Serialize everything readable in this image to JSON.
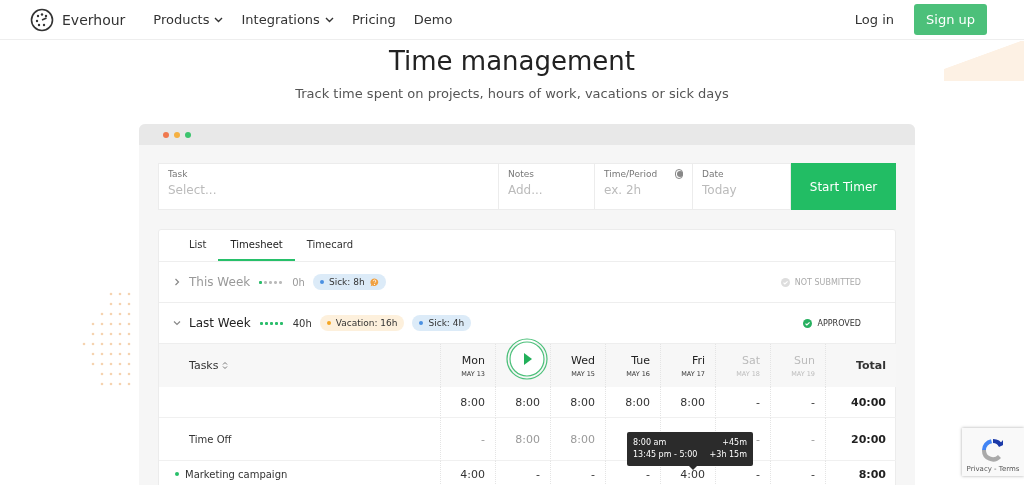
{
  "nav": {
    "brand": "Everhour",
    "links": [
      {
        "label": "Products",
        "dropdown": true
      },
      {
        "label": "Integrations",
        "dropdown": true
      },
      {
        "label": "Pricing",
        "dropdown": false
      },
      {
        "label": "Demo",
        "dropdown": false
      }
    ],
    "login": "Log in",
    "signup": "Sign up"
  },
  "hero": {
    "title": "Time management",
    "subtitle": "Track time spent on projects, hours of work, vacations or sick days"
  },
  "form": {
    "fields": [
      {
        "label": "Task",
        "placeholder": "Select..."
      },
      {
        "label": "Notes",
        "placeholder": "Add..."
      },
      {
        "label": "Time/Period",
        "placeholder": "ex. 2h",
        "toggle_on": false
      },
      {
        "label": "Date",
        "placeholder": "Today"
      }
    ],
    "button": "Start Timer"
  },
  "tabs": [
    {
      "label": "List",
      "selected": false
    },
    {
      "label": "Timesheet",
      "selected": true
    },
    {
      "label": "Timecard",
      "selected": false
    }
  ],
  "weeks": [
    {
      "title": "This Week",
      "expanded": false,
      "level": 0.17,
      "hours": "0h",
      "badges": [
        {
          "kind": "sick",
          "label": "Sick: 8h",
          "color": "#4a90e2",
          "note": true
        }
      ],
      "status": "NOT SUBMITTED",
      "approved": false
    },
    {
      "title": "Last Week",
      "expanded": true,
      "level": 1,
      "hours": "40h",
      "badges": [
        {
          "kind": "vacation",
          "label": "Vacation: 16h",
          "color": "#f5a623",
          "note": false
        },
        {
          "kind": "sick",
          "label": "Sick: 4h",
          "color": "#4a90e2",
          "note": false
        }
      ],
      "status": "APPROVED",
      "approved": true
    }
  ],
  "table": {
    "tasks_header": "Tasks",
    "days": [
      {
        "name": "Mon",
        "date": "MAY 13",
        "weekend": false
      },
      {
        "kind": "play_button"
      },
      {
        "name": "Wed",
        "date": "MAY 15",
        "weekend": false
      },
      {
        "name": "Tue",
        "date": "MAY 16",
        "weekend": false
      },
      {
        "name": "Fri",
        "date": "MAY 17",
        "weekend": false
      },
      {
        "name": "Sat",
        "date": "MAY 18",
        "weekend": true
      },
      {
        "name": "Sun",
        "date": "MAY 19",
        "weekend": true
      }
    ],
    "total_header": "Total",
    "rows": [
      {
        "cells": [
          "8:00",
          "8:00",
          "8:00",
          "8:00",
          "8:00",
          "-",
          "-"
        ],
        "total": "40:00",
        "muted": false
      },
      {
        "label": "Time Off",
        "cells": [
          "-",
          "8:00",
          "8:00",
          null,
          null,
          "-",
          "-"
        ],
        "total": "20:00",
        "muted": true
      },
      {
        "label": "Marketing campaign",
        "color": "#27c06a",
        "cells": [
          "4:00",
          "-",
          "-",
          "-",
          "4:00",
          "-",
          "-"
        ],
        "total": "8:00",
        "muted": false
      }
    ]
  },
  "tooltip": {
    "lines": [
      {
        "time": "8:00 am",
        "delta": "+45m"
      },
      {
        "time": "13:45 pm - 5:00",
        "delta": "+3h 15m"
      }
    ]
  },
  "recaptcha": {
    "links": "Privacy - Terms"
  }
}
